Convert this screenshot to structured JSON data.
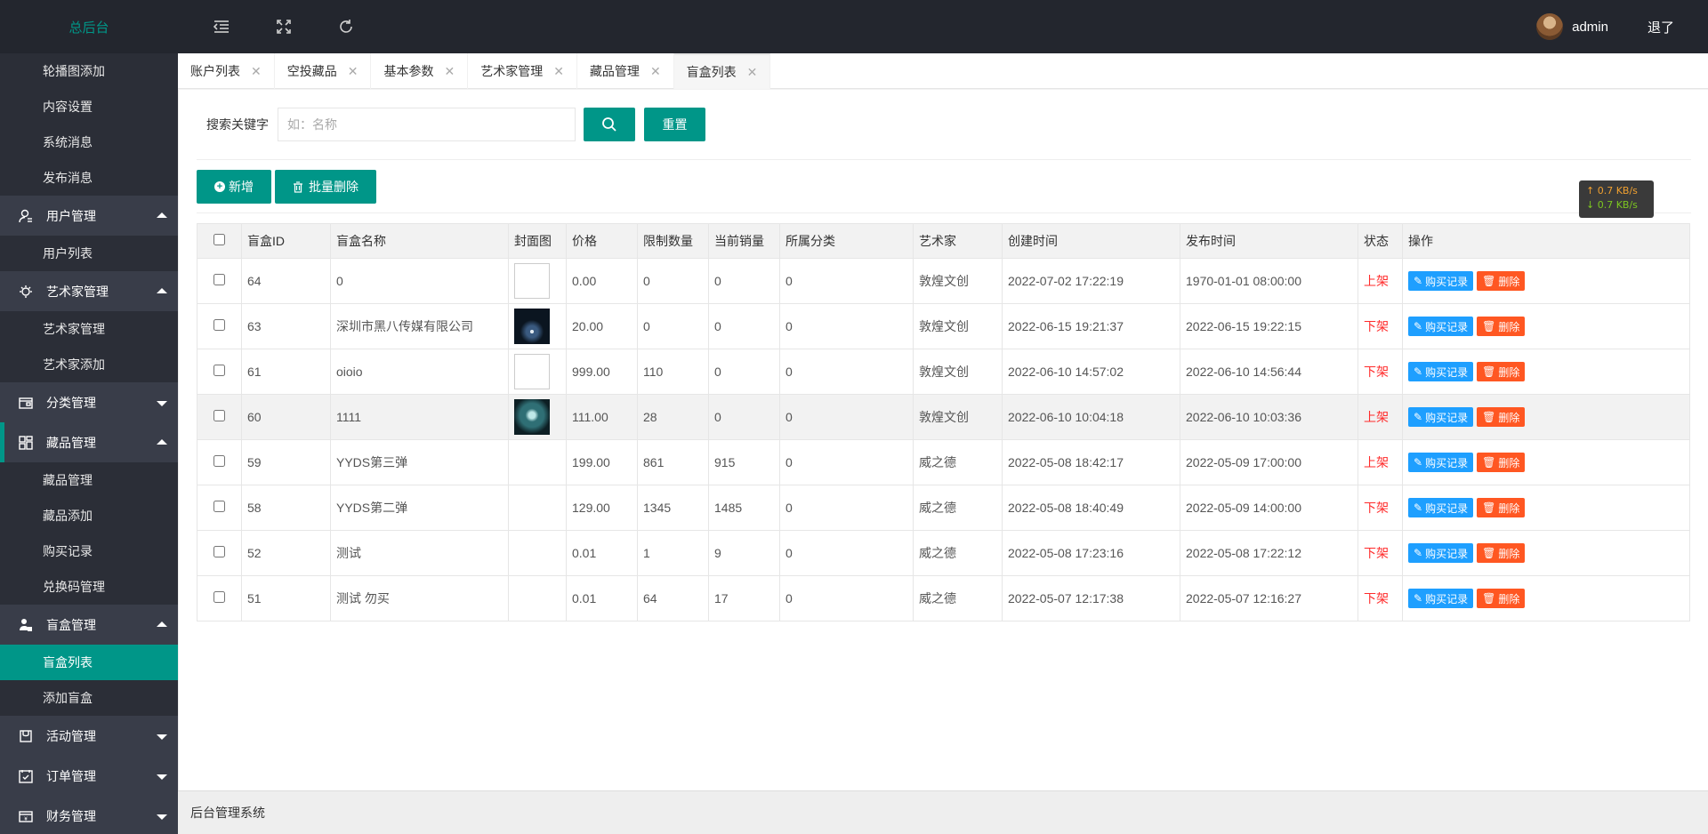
{
  "header": {
    "logo": "总后台",
    "user_name": "admin",
    "logout": "退了"
  },
  "sidebar": {
    "items": [
      {
        "type": "sub",
        "label": "轮播图添加"
      },
      {
        "type": "sub",
        "label": "内容设置"
      },
      {
        "type": "sub",
        "label": "系统消息"
      },
      {
        "type": "sub",
        "label": "发布消息"
      },
      {
        "type": "group",
        "label": "用户管理",
        "icon": "user-icon",
        "expanded": true
      },
      {
        "type": "sub",
        "label": "用户列表"
      },
      {
        "type": "group",
        "label": "艺术家管理",
        "icon": "artist-icon",
        "expanded": true
      },
      {
        "type": "sub",
        "label": "艺术家管理"
      },
      {
        "type": "sub",
        "label": "艺术家添加"
      },
      {
        "type": "group",
        "label": "分类管理",
        "icon": "category-icon",
        "expanded": false
      },
      {
        "type": "group",
        "label": "藏品管理",
        "icon": "grid-icon",
        "expanded": true,
        "current": true
      },
      {
        "type": "sub",
        "label": "藏品管理"
      },
      {
        "type": "sub",
        "label": "藏品添加"
      },
      {
        "type": "sub",
        "label": "购买记录"
      },
      {
        "type": "sub",
        "label": "兑换码管理"
      },
      {
        "type": "group",
        "label": "盲盒管理",
        "icon": "box-icon",
        "expanded": true
      },
      {
        "type": "sub",
        "label": "盲盒列表",
        "active": true
      },
      {
        "type": "sub",
        "label": "添加盲盒"
      },
      {
        "type": "group",
        "label": "活动管理",
        "icon": "activity-icon",
        "expanded": false
      },
      {
        "type": "group",
        "label": "订单管理",
        "icon": "order-icon",
        "expanded": false
      },
      {
        "type": "group",
        "label": "财务管理",
        "icon": "finance-icon",
        "expanded": false
      }
    ]
  },
  "tabs": [
    {
      "label": "账户列表"
    },
    {
      "label": "空投藏品"
    },
    {
      "label": "基本参数"
    },
    {
      "label": "艺术家管理"
    },
    {
      "label": "藏品管理"
    },
    {
      "label": "盲盒列表",
      "active": true
    }
  ],
  "search": {
    "label": "搜索关键字",
    "placeholder": "如：名称",
    "reset_label": "重置"
  },
  "actions": {
    "add_label": "新增",
    "batch_delete_label": "批量删除"
  },
  "speed": {
    "up": "0.7 KB/s",
    "down": "0.7 KB/s"
  },
  "table": {
    "headers": [
      "盲盒ID",
      "盲盒名称",
      "封面图",
      "价格",
      "限制数量",
      "当前销量",
      "所属分类",
      "艺术家",
      "创建时间",
      "发布时间",
      "状态",
      "操作"
    ],
    "buy_record_label": "购买记录",
    "delete_label": "删除",
    "rows": [
      {
        "id": "64",
        "name": "0",
        "cover": "broken",
        "price": "0.00",
        "limit": "0",
        "sold": "0",
        "category": "0",
        "artist": "敦煌文创",
        "created": "2022-07-02 17:22:19",
        "published": "1970-01-01 08:00:00",
        "status": "上架"
      },
      {
        "id": "63",
        "name": "深圳市黑八传媒有限公司",
        "cover": "dark",
        "price": "20.00",
        "limit": "0",
        "sold": "0",
        "category": "0",
        "artist": "敦煌文创",
        "created": "2022-06-15 19:21:37",
        "published": "2022-06-15 19:22:15",
        "status": "下架"
      },
      {
        "id": "61",
        "name": "oioio",
        "cover": "broken",
        "price": "999.00",
        "limit": "110",
        "sold": "0",
        "category": "0",
        "artist": "敦煌文创",
        "created": "2022-06-10 14:57:02",
        "published": "2022-06-10 14:56:44",
        "status": "下架"
      },
      {
        "id": "60",
        "name": "1111",
        "cover": "orb",
        "price": "111.00",
        "limit": "28",
        "sold": "0",
        "category": "0",
        "artist": "敦煌文创",
        "created": "2022-06-10 10:04:18",
        "published": "2022-06-10 10:03:36",
        "status": "上架"
      },
      {
        "id": "59",
        "name": "YYDS第三弹",
        "cover": "",
        "price": "199.00",
        "limit": "861",
        "sold": "915",
        "category": "0",
        "artist": "威之德",
        "created": "2022-05-08 18:42:17",
        "published": "2022-05-09 17:00:00",
        "status": "上架"
      },
      {
        "id": "58",
        "name": "YYDS第二弹",
        "cover": "",
        "price": "129.00",
        "limit": "1345",
        "sold": "1485",
        "category": "0",
        "artist": "威之德",
        "created": "2022-05-08 18:40:49",
        "published": "2022-05-09 14:00:00",
        "status": "下架"
      },
      {
        "id": "52",
        "name": "测试",
        "cover": "",
        "price": "0.01",
        "limit": "1",
        "sold": "9",
        "category": "0",
        "artist": "威之德",
        "created": "2022-05-08 17:23:16",
        "published": "2022-05-08 17:22:12",
        "status": "下架"
      },
      {
        "id": "51",
        "name": "测试 勿买",
        "cover": "",
        "price": "0.01",
        "limit": "64",
        "sold": "17",
        "category": "0",
        "artist": "威之德",
        "created": "2022-05-07 12:17:38",
        "published": "2022-05-07 12:16:27",
        "status": "下架"
      }
    ]
  },
  "footer": {
    "text": "后台管理系统"
  }
}
